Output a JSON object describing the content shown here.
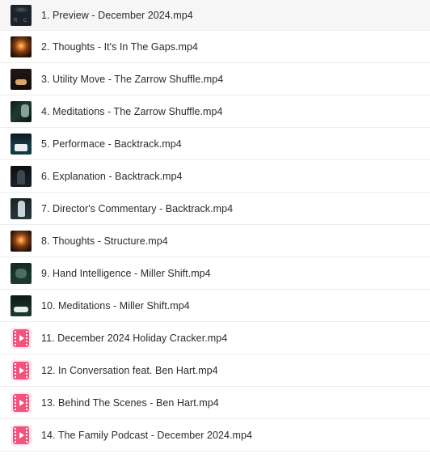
{
  "files": [
    {
      "name": "1. Preview - December 2024.mp4",
      "thumbnail": "rc-logo-thumbnail"
    },
    {
      "name": "2. Thoughts - It's In The Gaps.mp4",
      "thumbnail": "candle-thumbnail"
    },
    {
      "name": "3. Utility Move - The Zarrow Shuffle.mp4",
      "thumbnail": "cards-hands-thumbnail"
    },
    {
      "name": "4. Meditations - The Zarrow Shuffle.mp4",
      "thumbnail": "hand-thumbnail"
    },
    {
      "name": "5. Performace - Backtrack.mp4",
      "thumbnail": "cards-table-thumbnail"
    },
    {
      "name": "6. Explanation - Backtrack.mp4",
      "thumbnail": "presenter-thumbnail"
    },
    {
      "name": "7. Director's Commentary - Backtrack.mp4",
      "thumbnail": "presenter-thumbnail"
    },
    {
      "name": "8. Thoughts - Structure.mp4",
      "thumbnail": "candle-thumbnail"
    },
    {
      "name": "9. Hand Intelligence - Miller Shift.mp4",
      "thumbnail": "hand-thumbnail"
    },
    {
      "name": "10. Meditations - Miller Shift.mp4",
      "thumbnail": "cards-table-thumbnail"
    },
    {
      "name": "11. December 2024 Holiday Cracker.mp4",
      "thumbnail": "video-file-icon"
    },
    {
      "name": "12. In Conversation feat. Ben Hart.mp4",
      "thumbnail": "video-file-icon"
    },
    {
      "name": "13. Behind The Scenes - Ben Hart.mp4",
      "thumbnail": "video-file-icon"
    },
    {
      "name": "14. The Family Podcast - December 2024.mp4",
      "thumbnail": "video-file-icon"
    }
  ],
  "colors": {
    "text": "#2b2b2b",
    "divider": "#ececec",
    "selected_row_bg": "#f6f6f6",
    "video_icon_pink": "#f3527c"
  }
}
